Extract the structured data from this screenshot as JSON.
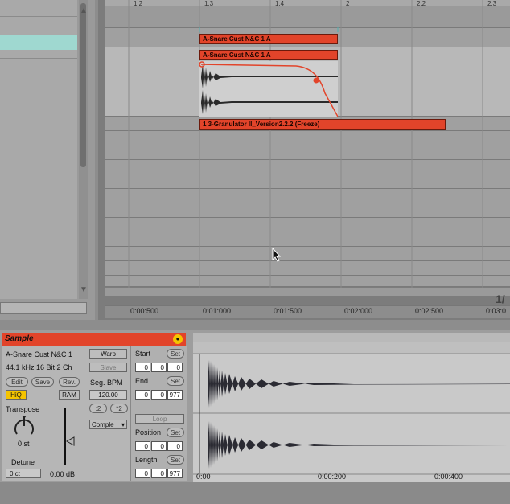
{
  "arrangement": {
    "bar_numbers": [
      "1.2",
      "1.3",
      "1.4",
      "2",
      "2.2",
      "2.3"
    ],
    "clips": {
      "top_clip": "A-Snare Cust N&C 1 A",
      "sample_clip": "A-Snare Cust N&C 1 A",
      "freeze_clip": "1 3-Granulator II_Version2.2.2 (Freeze)"
    },
    "timeline": [
      "0:00:500",
      "0:01:000",
      "0:01:500",
      "0:02:000",
      "0:02:500",
      "0:03:0"
    ],
    "zoom_label": "1/"
  },
  "device": {
    "title": "Sample",
    "sample_name": "A-Snare Cust N&C 1",
    "sample_info": "44.1 kHz 16 Bit 2 Ch",
    "edit_label": "Edit",
    "save_label": "Save",
    "rev_label": "Rev.",
    "hiq_label": "HiQ",
    "ram_label": "RAM",
    "transpose_label": "Transpose",
    "transpose_value": "0 st",
    "detune_label": "Detune",
    "detune_value": "0 ct",
    "gain_value": "0.00 dB",
    "warp_label": "Warp",
    "slave_label": "Slave",
    "seg_bpm_label": "Seg. BPM",
    "seg_bpm_value": "120.00",
    "half_label": ":2",
    "double_label": "*2",
    "warp_mode": "Comple",
    "start_label": "Start",
    "start_values": [
      "0",
      "0",
      "0"
    ],
    "end_label": "End",
    "end_values": [
      "0",
      "0",
      "977"
    ],
    "loop_label": "Loop",
    "position_label": "Position",
    "position_values": [
      "0",
      "0",
      "0"
    ],
    "length_label": "Length",
    "length_values": [
      "0",
      "0",
      "977"
    ],
    "set_label": "Set"
  },
  "sample_timeline": [
    "0:00",
    "0:00:200",
    "0:00:400"
  ]
}
